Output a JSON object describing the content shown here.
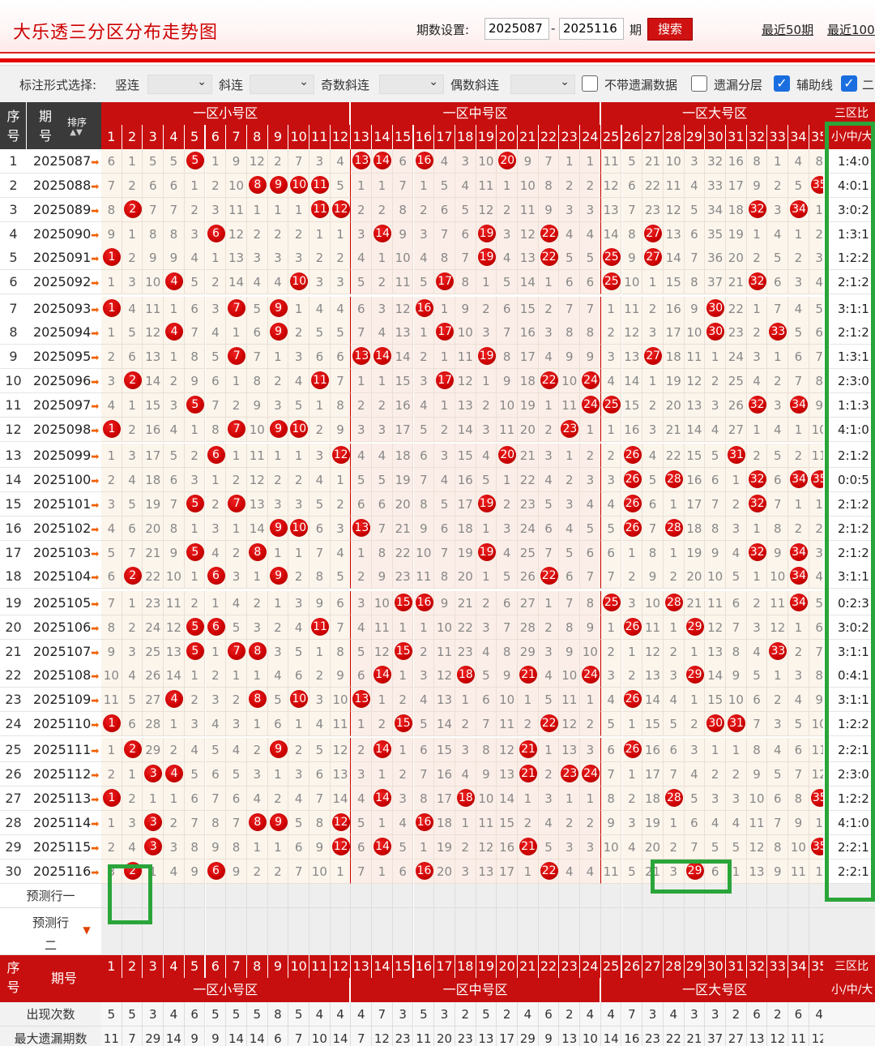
{
  "header": {
    "title": "大乐透三分区分布走势图",
    "period_label": "期数设置:",
    "from": "2025087",
    "to": "2025116",
    "qi": "期",
    "search": "搜索",
    "last50": "最近50期",
    "last100": "最近100期"
  },
  "options": {
    "label": "标注形式选择:",
    "vertical": "竖连",
    "diag": "斜连",
    "odd_diag": "奇数斜连",
    "even_diag": "偶数斜连",
    "no_omit": "不带遗漏数据",
    "omit_layer": "遗漏分层",
    "aux_line": "辅助线",
    "last_cb": "二"
  },
  "table": {
    "seq_header": "序号",
    "period_header": "期号",
    "sort_label": "排序",
    "zone1": "一区小号区",
    "zone2": "一区中号区",
    "zone3": "一区大号区",
    "ratio_header": "三区比",
    "ratio_sub": "小/中/大",
    "predict1": "预测行一",
    "predict2": "预测行二",
    "footer_rows": [
      {
        "label": "出现次数",
        "values": [
          "5",
          "5",
          "3",
          "4",
          "6",
          "5",
          "5",
          "5",
          "8",
          "5",
          "4",
          "4",
          "4",
          "7",
          "3",
          "5",
          "3",
          "2",
          "5",
          "2",
          "4",
          "6",
          "2",
          "4",
          "4",
          "7",
          "3",
          "4",
          "3",
          "3",
          "2",
          "6",
          "2",
          "6",
          "4"
        ]
      },
      {
        "label": "最大遗漏期数",
        "values": [
          "11",
          "7",
          "29",
          "14",
          "9",
          "9",
          "14",
          "14",
          "6",
          "7",
          "10",
          "14",
          "7",
          "12",
          "23",
          "11",
          "20",
          "23",
          "13",
          "17",
          "29",
          "9",
          "13",
          "10",
          "14",
          "16",
          "23",
          "22",
          "21",
          "37",
          "27",
          "13",
          "12",
          "11",
          "12"
        ]
      }
    ]
  },
  "rows": [
    [
      "1",
      "2025087",
      "6 1 5 5 *5 1 9 12 2 7 3 4 *13 *14 6 *16 4 3 10 *20 9 7 1 1 11 5 21 10 3 32 16 8 1 4 8",
      "1:4:0"
    ],
    [
      "2",
      "2025088",
      "7 2 6 6 1 2 10 *8 *9 *10 *11 5 1 1 7 1 5 4 11 1 10 8 2 2 12 6 22 11 4 33 17 9 2 5 *35",
      "4:0:1"
    ],
    [
      "3",
      "2025089",
      "8 *2 7 7 2 3 11 1 1 1 *11 *12 2 2 8 2 6 5 12 2 11 9 3 3 13 7 23 12 5 34 18 *32 3 *34 1",
      "3:0:2"
    ],
    [
      "4",
      "2025090",
      "9 1 8 8 3 *6 12 2 2 2 1 1 3 *14 9 3 7 6 *19 3 12 *22 4 4 14 8 *27 13 6 35 19 1 4 1 2",
      "1:3:1"
    ],
    [
      "5",
      "2025091",
      "*1 2 9 9 4 1 13 3 3 3 2 2 4 1 10 4 8 7 *19 4 13 *22 5 5 *25 9 *27 14 7 36 20 2 5 2 3",
      "1:2:2"
    ],
    [
      "6",
      "2025092",
      "1 3 10 *4 5 2 14 4 4 *10 3 3 5 2 11 5 *17 8 1 5 14 1 6 6 *25 10 1 15 8 37 21 *32 6 3 4",
      "2:1:2"
    ],
    [
      "7",
      "2025093",
      "*1 4 11 1 6 3 *7 5 *9 1 4 4 6 3 12 *16 1 9 2 6 15 2 7 7 1 11 2 16 9 *30 22 1 7 4 5",
      "3:1:1"
    ],
    [
      "8",
      "2025094",
      "1 5 12 *4 7 4 1 6 *9 2 5 5 7 4 13 1 *17 10 3 7 16 3 8 8 2 12 3 17 10 *30 23 2 *33 5 6",
      "2:1:2"
    ],
    [
      "9",
      "2025095",
      "2 6 13 1 8 5 *7 7 1 3 6 6 *13 *14 14 2 1 11 *19 8 17 4 9 9 3 13 *27 18 11 1 24 3 1 6 7",
      "1:3:1"
    ],
    [
      "10",
      "2025096",
      "3 *2 14 2 9 6 1 8 2 4 *11 7 1 1 15 3 *17 12 1 9 18 *22 10 *24 4 14 1 19 12 2 25 4 2 7 8",
      "2:3:0"
    ],
    [
      "11",
      "2025097",
      "4 1 15 3 *5 7 2 9 3 5 1 8 2 2 16 4 1 13 2 10 19 1 11 *24 *25 15 2 20 13 3 26 *32 3 *34 9",
      "1:1:3"
    ],
    [
      "12",
      "2025098",
      "*1 2 16 4 1 8 *7 10 *9 *10 2 9 3 3 17 5 2 14 3 11 20 2 *23 1 1 16 3 21 14 4 27 1 4 1 10",
      "4:1:0"
    ],
    [
      "13",
      "2025099",
      "1 3 17 5 2 *6 1 11 1 1 3 *12 4 4 18 6 3 15 4 *20 21 3 1 2 2 *26 4 22 15 5 *31 2 5 2 11",
      "2:1:2"
    ],
    [
      "14",
      "2025100",
      "2 4 18 6 3 1 2 12 2 2 4 1 5 5 19 7 4 16 5 1 22 4 2 3 3 *26 5 *28 16 6 1 *32 6 *34 *35",
      "0:0:5"
    ],
    [
      "15",
      "2025101",
      "3 5 19 7 *5 2 *7 13 3 3 5 2 6 6 20 8 5 17 *19 2 23 5 3 4 4 *26 6 1 17 7 2 *32 7 1 1",
      "2:1:2"
    ],
    [
      "16",
      "2025102",
      "4 6 20 8 1 3 1 14 *9 *10 6 3 *13 7 21 9 6 18 1 3 24 6 4 5 5 *26 7 *28 18 8 3 1 8 2 2",
      "2:1:2"
    ],
    [
      "17",
      "2025103",
      "5 7 21 9 *5 4 2 *8 1 1 7 4 1 8 22 10 7 19 *19 4 25 7 5 6 6 1 8 1 19 9 4 *32 9 *34 3",
      "2:1:2"
    ],
    [
      "18",
      "2025104",
      "6 *2 22 10 1 *6 3 1 *9 2 8 5 2 9 23 11 8 20 1 5 26 *22 6 7 7 2 9 2 20 10 5 1 10 *34 4",
      "3:1:1"
    ],
    [
      "19",
      "2025105",
      "7 1 23 11 2 1 4 2 1 3 9 6 3 10 *15 *16 9 21 2 6 27 1 7 8 *25 3 10 *28 21 11 6 2 11 *34 5",
      "0:2:3"
    ],
    [
      "20",
      "2025106",
      "8 2 24 12 *5 *6 5 3 2 4 *11 7 4 11 1 1 10 22 3 7 28 2 8 9 1 *26 11 1 *29 12 7 3 12 1 6",
      "3:0:2"
    ],
    [
      "21",
      "2025107",
      "9 3 25 13 *5 1 *7 *8 3 5 1 8 5 12 *15 2 11 23 4 8 29 3 9 10 2 1 12 2 1 13 8 4 *33 2 7",
      "3:1:1"
    ],
    [
      "22",
      "2025108",
      "10 4 26 14 1 2 1 1 4 6 2 9 6 *14 1 3 12 *18 5 9 *21 4 10 *24 3 2 13 3 *29 14 9 5 1 3 8",
      "0:4:1"
    ],
    [
      "23",
      "2025109",
      "11 5 27 *4 2 3 2 *8 5 *10 3 10 *13 1 2 4 13 1 6 10 1 5 11 1 4 *26 14 4 1 15 10 6 2 4 9",
      "3:1:1"
    ],
    [
      "24",
      "2025110",
      "*1 6 28 1 3 4 3 1 6 1 4 11 1 2 *15 5 14 2 7 11 2 *22 12 2 5 1 15 5 2 *30 *31 7 3 5 10",
      "1:2:2"
    ],
    [
      "25",
      "2025111",
      "1 *2 29 2 4 5 4 2 *9 2 5 12 2 *14 1 6 15 3 8 12 *21 1 13 3 6 *26 16 6 3 1 1 8 4 6 11",
      "2:2:1"
    ],
    [
      "26",
      "2025112",
      "2 1 *3 *4 5 6 5 3 1 3 6 13 3 1 2 7 16 4 9 13 *21 2 *23 *24 7 1 17 7 4 2 2 9 5 7 12",
      "2:3:0"
    ],
    [
      "27",
      "2025113",
      "*1 2 1 1 6 7 6 4 2 4 7 14 4 *14 3 8 17 *18 10 14 1 3 1 1 8 2 18 *28 5 3 3 10 6 8 *35",
      "1:2:2"
    ],
    [
      "28",
      "2025114",
      "1 3 *3 2 7 8 7 *8 *9 5 8 *12 5 1 4 *16 18 1 11 15 2 4 2 2 9 3 19 1 6 4 4 11 7 9 1",
      "4:1:0"
    ],
    [
      "29",
      "2025115",
      "2 4 *3 3 8 9 8 1 1 6 9 *12 6 *14 5 1 19 2 12 16 *21 5 3 3 10 4 20 2 7 5 5 12 8 10 *35",
      "2:2:1"
    ],
    [
      "30",
      "2025116",
      "3 *2 1 4 9 *6 9 2 2 7 10 1 7 1 6 *16 20 3 13 17 1 *22 4 4 11 5 21 3 *29 6 1 13 9 11 1",
      "2:2:1"
    ]
  ]
}
